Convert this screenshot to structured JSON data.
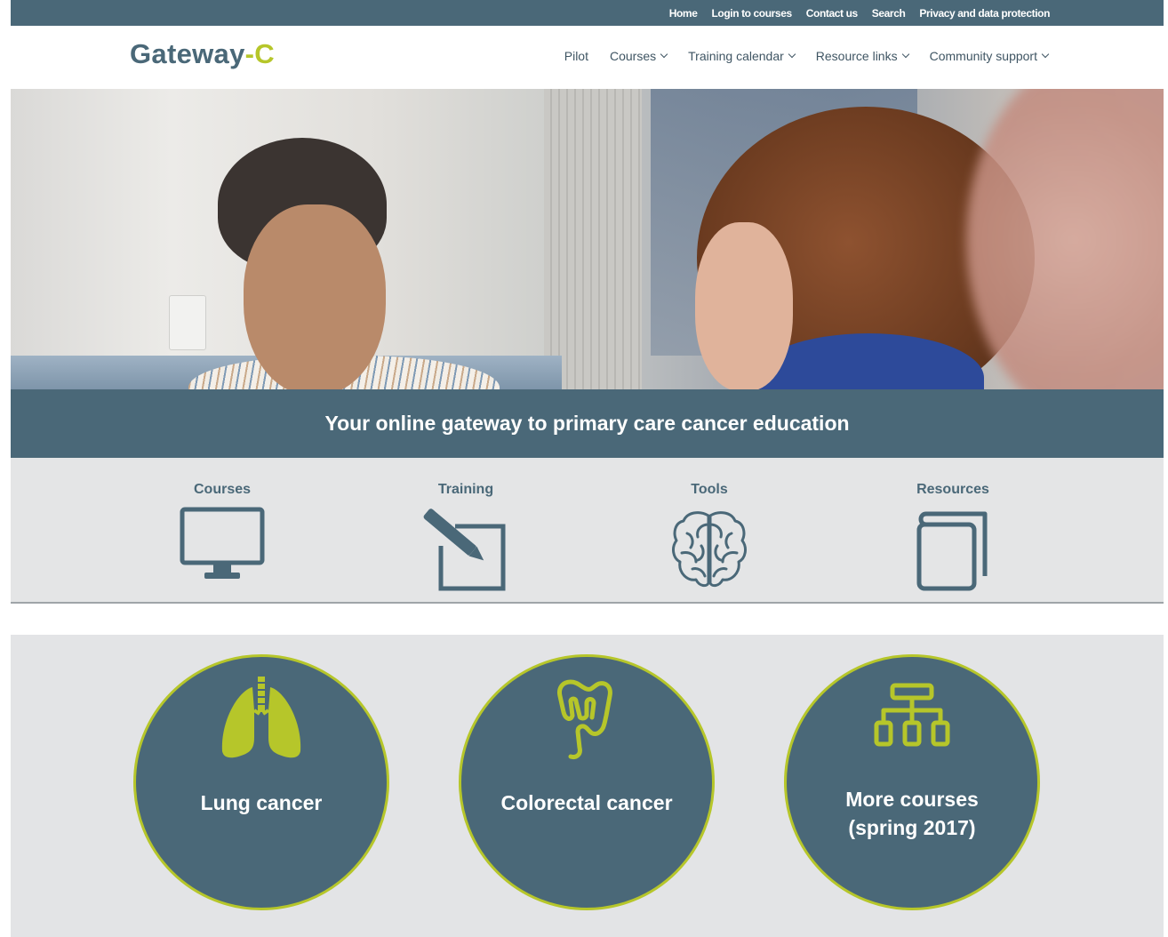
{
  "top_links": [
    "Home",
    "Login to courses",
    "Contact us",
    "Search",
    "Privacy and data protection"
  ],
  "logo": {
    "main": "Gateway",
    "dash_c": "-C"
  },
  "nav": [
    {
      "label": "Pilot",
      "dropdown": false
    },
    {
      "label": "Courses",
      "dropdown": true
    },
    {
      "label": "Training calendar",
      "dropdown": true
    },
    {
      "label": "Resource links",
      "dropdown": true
    },
    {
      "label": "Community support",
      "dropdown": true
    }
  ],
  "banner": "Your online gateway to primary care cancer education",
  "features": [
    {
      "label": "Courses",
      "icon": "monitor-icon"
    },
    {
      "label": "Training",
      "icon": "pencil-icon"
    },
    {
      "label": "Tools",
      "icon": "brain-icon"
    },
    {
      "label": "Resources",
      "icon": "book-icon"
    }
  ],
  "courses": [
    {
      "label": "Lung cancer",
      "icon": "lungs-icon"
    },
    {
      "label": "Colorectal cancer",
      "icon": "colon-icon"
    },
    {
      "label": "More courses\n(spring 2017)",
      "icon": "sitemap-icon"
    }
  ],
  "colors": {
    "brand_slate": "#4a6878",
    "brand_lime": "#b6c62a",
    "panel_grey": "#e4e5e6"
  }
}
